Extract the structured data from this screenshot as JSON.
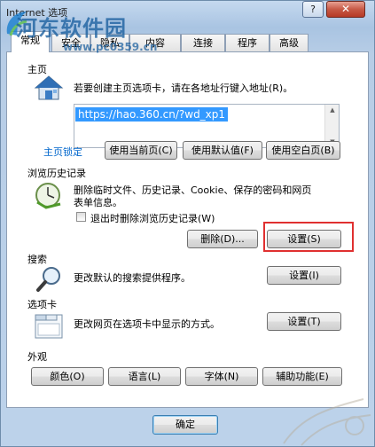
{
  "window": {
    "title": "Internet 选项",
    "help_label": "?",
    "close_label": "✕"
  },
  "watermark": {
    "site_name": "河东软件园",
    "url": "www.pc0359.cn"
  },
  "tabs": [
    {
      "label": "常规",
      "active": true
    },
    {
      "label": "安全"
    },
    {
      "label": "隐私"
    },
    {
      "label": "内容"
    },
    {
      "label": "连接"
    },
    {
      "label": "程序"
    },
    {
      "label": "高级"
    }
  ],
  "home_page": {
    "heading": "主页",
    "description": "若要创建主页选项卡，请在各地址行键入地址(R)。",
    "url": "https://hao.360.cn/?wd_xp1",
    "lock_link": "主页锁定",
    "use_current": "使用当前页(C)",
    "use_default": "使用默认值(F)",
    "use_blank": "使用空白页(B)",
    "icon": "home-icon"
  },
  "history": {
    "heading": "浏览历史记录",
    "description_line1": "删除临时文件、历史记录、Cookie、保存的密码和网页",
    "description_line2": "表单信息。",
    "checkbox_label": "退出时删除浏览历史记录(W)",
    "checkbox_checked": false,
    "delete_button": "删除(D)...",
    "settings_button": "设置(S)",
    "icon": "history-clock-icon"
  },
  "search": {
    "heading": "搜索",
    "description": "更改默认的搜索提供程序。",
    "settings_button": "设置(I)",
    "icon": "magnifier-icon"
  },
  "tabs_section": {
    "heading": "选项卡",
    "description": "更改网页在选项卡中显示的方式。",
    "settings_button": "设置(T)",
    "icon": "tabs-window-icon"
  },
  "appearance": {
    "heading": "外观",
    "colors_button": "颜色(O)",
    "languages_button": "语言(L)",
    "fonts_button": "字体(N)",
    "accessibility_button": "辅助功能(E)"
  },
  "footer": {
    "ok_button": "确定"
  },
  "colors": {
    "highlight": "#e03030",
    "selection": "#3399ff",
    "link": "#0066cc"
  }
}
